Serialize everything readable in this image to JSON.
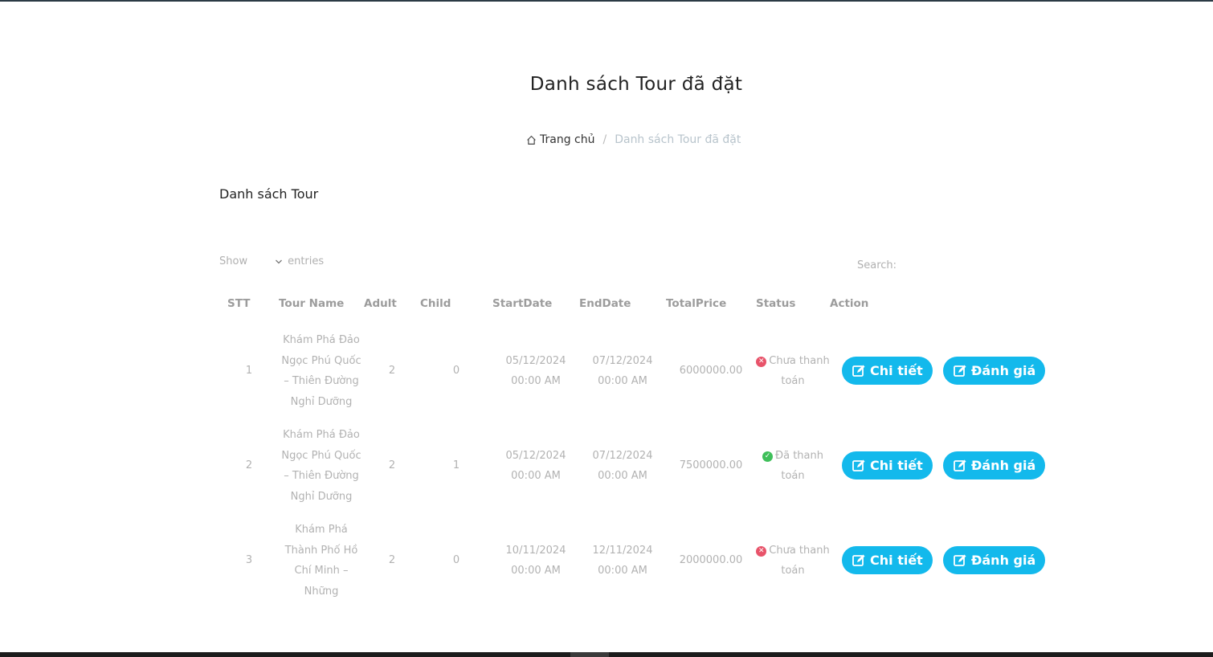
{
  "header": {
    "title": "Danh sách Tour đã đặt",
    "breadcrumb_home": "Trang chủ",
    "breadcrumb_separator": "/",
    "breadcrumb_current": "Danh sách Tour đã đặt"
  },
  "section_title": "Danh sách Tour",
  "controls": {
    "show_label": "Show",
    "entries_label": "entries",
    "search_label": "Search:",
    "search_value": ""
  },
  "table": {
    "columns": [
      "STT",
      "Tour Name",
      "Adult",
      "Child",
      "StartDate",
      "EndDate",
      "TotalPrice",
      "Status",
      "Action"
    ],
    "rows": [
      {
        "stt": "1",
        "tour_name": "Khám Phá Đảo Ngọc Phú Quốc – Thiên Đường Nghỉ Dưỡng",
        "adult": "2",
        "child": "0",
        "start_date": "05/12/2024 00:00 AM",
        "end_date": "07/12/2024 00:00 AM",
        "total_price": "6000000.00",
        "status": "Chưa thanh toán",
        "status_kind": "unpaid",
        "detail_label": "Chi tiết",
        "review_label": "Đánh giá"
      },
      {
        "stt": "2",
        "tour_name": "Khám Phá Đảo Ngọc Phú Quốc – Thiên Đường Nghỉ Dưỡng",
        "adult": "2",
        "child": "1",
        "start_date": "05/12/2024 00:00 AM",
        "end_date": "07/12/2024 00:00 AM",
        "total_price": "7500000.00",
        "status": "Đã thanh toán",
        "status_kind": "paid",
        "detail_label": "Chi tiết",
        "review_label": "Đánh giá"
      },
      {
        "stt": "3",
        "tour_name": "Khám Phá Thành Phố Hồ Chí Minh – Những",
        "adult": "2",
        "child": "0",
        "start_date": "10/11/2024 00:00 AM",
        "end_date": "12/11/2024 00:00 AM",
        "total_price": "2000000.00",
        "status": "Chưa thanh toán",
        "status_kind": "unpaid",
        "detail_label": "Chi tiết",
        "review_label": "Đánh giá"
      }
    ]
  },
  "colors": {
    "accent_button": "#13b9ec",
    "status_unpaid": "#e8536a",
    "status_paid": "#3fbf5a"
  },
  "icons": {
    "home": "home-icon",
    "unpaid": "times-circle-icon",
    "paid": "check-circle-icon",
    "button": "edit-icon",
    "select": "chevron-down-icon"
  }
}
